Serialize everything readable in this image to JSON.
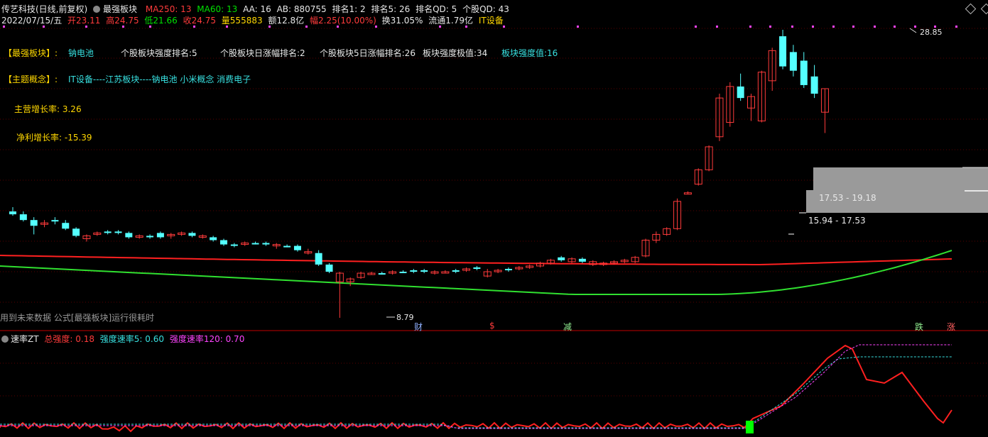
{
  "header": {
    "stock": "传艺科技(日线,前复权)",
    "indicator": "最强板块",
    "ma250": "MA250: 13",
    "ma60": "MA60: 13",
    "aa": "AA: 16",
    "ab": "AB: 880755",
    "rank1": "排名1: 2",
    "rank5": "排名5: 26",
    "rank_qd": "排名QD: 5",
    "stock_qd": "个股QD: 43"
  },
  "quote": {
    "date": "2022/07/15/五",
    "open": "开23.11",
    "high": "高24.75",
    "low": "低21.66",
    "close": "收24.75",
    "volume": "量555883",
    "amount": "额12.8亿",
    "change": "幅2.25(10.00%)",
    "turnover": "换31.05%",
    "float": "流通1.79亿",
    "sector": "IT设备"
  },
  "info": {
    "strongest_label": "【最强板块】:",
    "strongest_value": "钠电池",
    "rank_strength": "个股板块强度排名:5",
    "rank_daily": "个股板块日涨幅排名:2",
    "rank_5day": "个股板块5日涨幅排名:26",
    "strength_max": "板块强度极值:34",
    "strength_val": "板块强度值:16",
    "concept_label": "【主题概念】:",
    "concept_value": "IT设备----江苏板块----钠电池 小米概念 消费电子",
    "growth_main": "主营增长率: 3.26",
    "growth_net": "净利增长率: -15.39"
  },
  "annotations": {
    "high_price": "28.85",
    "low_price": "8.79",
    "band1": "17.53 - 19.18",
    "band2": "15.94 - 17.53",
    "future_note": "用到未来数据 公式[最强板块]运行很耗时",
    "m_cai": "财",
    "m_yin": "$",
    "m_jian": "减",
    "m_die": "跌",
    "m_zhang": "涨"
  },
  "lower": {
    "name": "速率ZT",
    "total": "总强度: 0.18",
    "rate5": "强度速率5: 0.60",
    "rate120": "强度速率120: 0.70"
  },
  "colors": {
    "up": "#ff3b3b",
    "down": "#54ffff",
    "ma250": "#ff2020",
    "ma60": "#30e030",
    "magenta": "#ff44ff",
    "cyan": "#38e0e0"
  },
  "chart_data": {
    "type": "candlestick",
    "price_range": [
      8.79,
      28.85
    ],
    "candles_approx": [
      {
        "o": 16.2,
        "h": 16.5,
        "l": 15.9,
        "c": 16.0,
        "dir": "down"
      },
      {
        "o": 16.0,
        "h": 16.2,
        "l": 15.5,
        "c": 15.6,
        "dir": "down"
      },
      {
        "o": 15.6,
        "h": 15.8,
        "l": 14.6,
        "c": 15.2,
        "dir": "down"
      },
      {
        "o": 15.3,
        "h": 15.6,
        "l": 15.1,
        "c": 15.4,
        "dir": "up"
      },
      {
        "o": 15.6,
        "h": 15.8,
        "l": 15.3,
        "c": 15.5,
        "dir": "down"
      },
      {
        "o": 15.4,
        "h": 15.6,
        "l": 14.9,
        "c": 15.0,
        "dir": "down"
      },
      {
        "o": 15.0,
        "h": 15.1,
        "l": 14.4,
        "c": 14.5,
        "dir": "down"
      },
      {
        "o": 14.5,
        "h": 14.6,
        "l": 14.1,
        "c": 14.3,
        "dir": "up"
      },
      {
        "o": 14.6,
        "h": 14.8,
        "l": 14.5,
        "c": 14.7,
        "dir": "up"
      },
      {
        "o": 14.7,
        "h": 14.9,
        "l": 14.6,
        "c": 14.8,
        "dir": "down"
      },
      {
        "o": 14.8,
        "h": 14.9,
        "l": 14.6,
        "c": 14.7,
        "dir": "down"
      },
      {
        "o": 14.7,
        "h": 14.8,
        "l": 14.3,
        "c": 14.4,
        "dir": "down"
      },
      {
        "o": 14.4,
        "h": 14.6,
        "l": 14.3,
        "c": 14.5,
        "dir": "up"
      },
      {
        "o": 14.5,
        "h": 14.6,
        "l": 14.3,
        "c": 14.4,
        "dir": "down"
      },
      {
        "o": 14.4,
        "h": 14.8,
        "l": 14.3,
        "c": 14.7,
        "dir": "down"
      },
      {
        "o": 14.5,
        "h": 14.7,
        "l": 14.3,
        "c": 14.6,
        "dir": "up"
      },
      {
        "o": 14.6,
        "h": 14.8,
        "l": 14.5,
        "c": 14.7,
        "dir": "up"
      },
      {
        "o": 14.7,
        "h": 14.8,
        "l": 14.4,
        "c": 14.5,
        "dir": "down"
      },
      {
        "o": 14.5,
        "h": 14.6,
        "l": 14.3,
        "c": 14.4,
        "dir": "up"
      },
      {
        "o": 14.4,
        "h": 14.5,
        "l": 14.1,
        "c": 14.2,
        "dir": "down"
      },
      {
        "o": 14.2,
        "h": 14.3,
        "l": 13.8,
        "c": 13.9,
        "dir": "down"
      },
      {
        "o": 13.9,
        "h": 14.0,
        "l": 13.7,
        "c": 13.9,
        "dir": "down"
      },
      {
        "o": 13.9,
        "h": 14.1,
        "l": 13.8,
        "c": 14.0,
        "dir": "up"
      },
      {
        "o": 14.0,
        "h": 14.1,
        "l": 13.9,
        "c": 14.0,
        "dir": "down"
      },
      {
        "o": 14.0,
        "h": 14.1,
        "l": 13.8,
        "c": 13.9,
        "dir": "down"
      },
      {
        "o": 13.9,
        "h": 14.0,
        "l": 13.6,
        "c": 13.8,
        "dir": "up"
      },
      {
        "o": 13.8,
        "h": 13.9,
        "l": 13.7,
        "c": 13.8,
        "dir": "down"
      },
      {
        "o": 13.8,
        "h": 13.9,
        "l": 13.4,
        "c": 13.5,
        "dir": "down"
      },
      {
        "o": 13.4,
        "h": 13.6,
        "l": 13.2,
        "c": 13.3,
        "dir": "up"
      },
      {
        "o": 13.3,
        "h": 13.5,
        "l": 12.4,
        "c": 12.5,
        "dir": "down"
      },
      {
        "o": 12.5,
        "h": 12.6,
        "l": 11.9,
        "c": 12.0,
        "dir": "down"
      },
      {
        "o": 11.9,
        "h": 12.0,
        "l": 8.79,
        "c": 11.3,
        "dir": "up"
      },
      {
        "o": 11.3,
        "h": 11.6,
        "l": 11.0,
        "c": 11.5,
        "dir": "up"
      },
      {
        "o": 11.6,
        "h": 12.0,
        "l": 11.5,
        "c": 11.9,
        "dir": "up"
      },
      {
        "o": 11.9,
        "h": 12.0,
        "l": 11.8,
        "c": 11.9,
        "dir": "up"
      },
      {
        "o": 11.9,
        "h": 12.0,
        "l": 11.8,
        "c": 11.9,
        "dir": "down"
      },
      {
        "o": 11.9,
        "h": 12.1,
        "l": 11.8,
        "c": 12.0,
        "dir": "up"
      },
      {
        "o": 12.0,
        "h": 12.1,
        "l": 11.9,
        "c": 12.0,
        "dir": "down"
      },
      {
        "o": 12.0,
        "h": 12.2,
        "l": 11.9,
        "c": 12.1,
        "dir": "down"
      },
      {
        "o": 12.1,
        "h": 12.2,
        "l": 11.9,
        "c": 12.0,
        "dir": "down"
      },
      {
        "o": 11.9,
        "h": 12.1,
        "l": 11.8,
        "c": 12.0,
        "dir": "up"
      },
      {
        "o": 12.0,
        "h": 12.1,
        "l": 11.9,
        "c": 12.0,
        "dir": "up"
      },
      {
        "o": 12.0,
        "h": 12.2,
        "l": 11.9,
        "c": 12.1,
        "dir": "down"
      },
      {
        "o": 12.1,
        "h": 12.3,
        "l": 12.0,
        "c": 12.2,
        "dir": "up"
      },
      {
        "o": 12.2,
        "h": 12.4,
        "l": 12.1,
        "c": 12.3,
        "dir": "down"
      },
      {
        "o": 11.7,
        "h": 12.2,
        "l": 11.6,
        "c": 12.0,
        "dir": "up"
      },
      {
        "o": 12.0,
        "h": 12.2,
        "l": 11.9,
        "c": 12.1,
        "dir": "up"
      },
      {
        "o": 12.1,
        "h": 12.3,
        "l": 12.0,
        "c": 12.2,
        "dir": "down"
      },
      {
        "o": 12.2,
        "h": 12.4,
        "l": 12.1,
        "c": 12.3,
        "dir": "up"
      },
      {
        "o": 12.3,
        "h": 12.5,
        "l": 12.2,
        "c": 12.4,
        "dir": "up"
      },
      {
        "o": 12.4,
        "h": 12.7,
        "l": 12.3,
        "c": 12.6,
        "dir": "up"
      },
      {
        "o": 12.6,
        "h": 12.9,
        "l": 12.5,
        "c": 12.8,
        "dir": "up"
      },
      {
        "o": 12.8,
        "h": 13.1,
        "l": 12.7,
        "c": 13.0,
        "dir": "down"
      },
      {
        "o": 12.9,
        "h": 13.0,
        "l": 12.6,
        "c": 12.7,
        "dir": "up"
      },
      {
        "o": 12.7,
        "h": 13.0,
        "l": 12.6,
        "c": 12.9,
        "dir": "down"
      },
      {
        "o": 12.7,
        "h": 12.8,
        "l": 12.4,
        "c": 12.5,
        "dir": "up"
      },
      {
        "o": 12.5,
        "h": 12.7,
        "l": 12.4,
        "c": 12.6,
        "dir": "up"
      },
      {
        "o": 12.6,
        "h": 12.8,
        "l": 12.5,
        "c": 12.7,
        "dir": "up"
      },
      {
        "o": 12.8,
        "h": 12.9,
        "l": 12.6,
        "c": 12.7,
        "dir": "up"
      },
      {
        "o": 12.7,
        "h": 13.1,
        "l": 12.6,
        "c": 13.0,
        "dir": "up"
      },
      {
        "o": 13.1,
        "h": 14.3,
        "l": 13.0,
        "c": 14.2,
        "dir": "up"
      },
      {
        "o": 14.2,
        "h": 14.8,
        "l": 14.0,
        "c": 14.6,
        "dir": "up"
      },
      {
        "o": 14.6,
        "h": 15.1,
        "l": 14.5,
        "c": 15.0,
        "dir": "up"
      },
      {
        "o": 15.0,
        "h": 17.1,
        "l": 14.9,
        "c": 16.9,
        "dir": "up"
      },
      {
        "o": 17.5,
        "h": 17.6,
        "l": 17.4,
        "c": 17.5,
        "dir": "up"
      },
      {
        "o": 18.1,
        "h": 19.2,
        "l": 18.0,
        "c": 19.1,
        "dir": "up"
      },
      {
        "o": 19.1,
        "h": 20.8,
        "l": 19.0,
        "c": 20.7,
        "dir": "up"
      },
      {
        "o": 21.4,
        "h": 24.4,
        "l": 21.1,
        "c": 24.1,
        "dir": "up"
      },
      {
        "o": 22.4,
        "h": 25.2,
        "l": 22.1,
        "c": 24.9,
        "dir": "up"
      },
      {
        "o": 24.9,
        "h": 25.8,
        "l": 23.9,
        "c": 24.1,
        "dir": "down"
      },
      {
        "o": 23.4,
        "h": 24.4,
        "l": 22.5,
        "c": 24.2,
        "dir": "up"
      },
      {
        "o": 22.5,
        "h": 26.0,
        "l": 22.4,
        "c": 25.9,
        "dir": "up"
      },
      {
        "o": 25.3,
        "h": 27.6,
        "l": 24.6,
        "c": 27.4,
        "dir": "up"
      },
      {
        "o": 28.4,
        "h": 28.85,
        "l": 26.1,
        "c": 26.3,
        "dir": "down"
      },
      {
        "o": 27.3,
        "h": 27.8,
        "l": 25.6,
        "c": 26.0,
        "dir": "down"
      },
      {
        "o": 26.7,
        "h": 27.3,
        "l": 24.8,
        "c": 25.0,
        "dir": "down"
      },
      {
        "o": 25.6,
        "h": 26.4,
        "l": 24.1,
        "c": 24.4,
        "dir": "down"
      },
      {
        "o": 23.11,
        "h": 24.75,
        "l": 21.66,
        "c": 24.75,
        "dir": "up"
      }
    ]
  }
}
